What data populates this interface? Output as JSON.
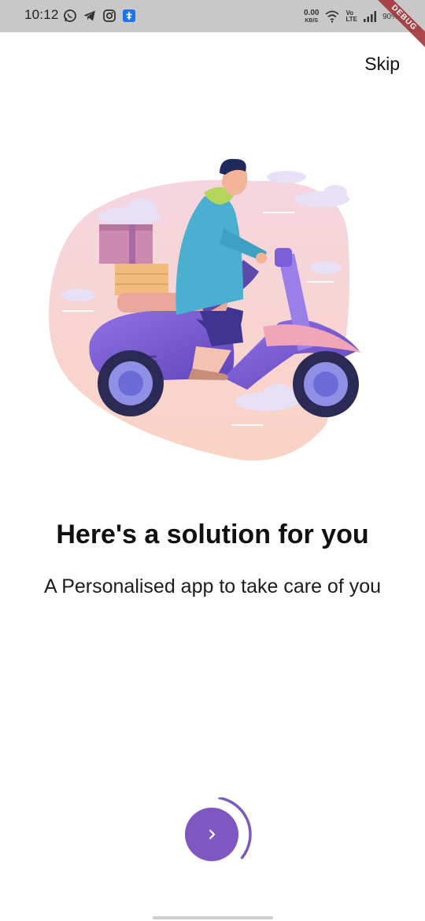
{
  "status_bar": {
    "time": "10:12",
    "net_speed_value": "0.00",
    "net_speed_unit": "KB/S",
    "volte_top": "Vo",
    "volte_bottom": "LTE",
    "battery": "90%",
    "icons": [
      "whatsapp-icon",
      "telegram-icon",
      "instagram-icon",
      "app-notification-icon",
      "wifi-icon",
      "signal-icon",
      "battery-icon"
    ]
  },
  "debug_banner": "DEBUG",
  "header": {
    "skip_label": "Skip"
  },
  "onboarding": {
    "title": "Here's a solution for you",
    "subtitle": "A Personalised app to take care of you",
    "progress_fraction": 0.33
  },
  "colors": {
    "accent": "#7e57c2",
    "status_bar_bg": "#c8c8c8",
    "blob": "#f8d9d0"
  }
}
